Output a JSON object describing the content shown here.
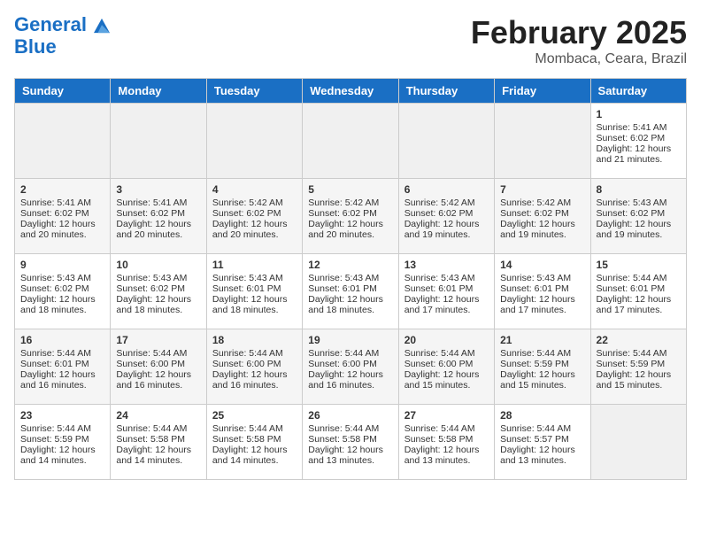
{
  "header": {
    "logo_line1": "General",
    "logo_line2": "Blue",
    "title": "February 2025",
    "subtitle": "Mombaca, Ceara, Brazil"
  },
  "days_of_week": [
    "Sunday",
    "Monday",
    "Tuesday",
    "Wednesday",
    "Thursday",
    "Friday",
    "Saturday"
  ],
  "weeks": [
    [
      {
        "num": "",
        "info": "",
        "empty": true
      },
      {
        "num": "",
        "info": "",
        "empty": true
      },
      {
        "num": "",
        "info": "",
        "empty": true
      },
      {
        "num": "",
        "info": "",
        "empty": true
      },
      {
        "num": "",
        "info": "",
        "empty": true
      },
      {
        "num": "",
        "info": "",
        "empty": true
      },
      {
        "num": "1",
        "info": "Sunrise: 5:41 AM\nSunset: 6:02 PM\nDaylight: 12 hours\nand 21 minutes.",
        "empty": false
      }
    ],
    [
      {
        "num": "2",
        "info": "Sunrise: 5:41 AM\nSunset: 6:02 PM\nDaylight: 12 hours\nand 20 minutes.",
        "empty": false
      },
      {
        "num": "3",
        "info": "Sunrise: 5:41 AM\nSunset: 6:02 PM\nDaylight: 12 hours\nand 20 minutes.",
        "empty": false
      },
      {
        "num": "4",
        "info": "Sunrise: 5:42 AM\nSunset: 6:02 PM\nDaylight: 12 hours\nand 20 minutes.",
        "empty": false
      },
      {
        "num": "5",
        "info": "Sunrise: 5:42 AM\nSunset: 6:02 PM\nDaylight: 12 hours\nand 20 minutes.",
        "empty": false
      },
      {
        "num": "6",
        "info": "Sunrise: 5:42 AM\nSunset: 6:02 PM\nDaylight: 12 hours\nand 19 minutes.",
        "empty": false
      },
      {
        "num": "7",
        "info": "Sunrise: 5:42 AM\nSunset: 6:02 PM\nDaylight: 12 hours\nand 19 minutes.",
        "empty": false
      },
      {
        "num": "8",
        "info": "Sunrise: 5:43 AM\nSunset: 6:02 PM\nDaylight: 12 hours\nand 19 minutes.",
        "empty": false
      }
    ],
    [
      {
        "num": "9",
        "info": "Sunrise: 5:43 AM\nSunset: 6:02 PM\nDaylight: 12 hours\nand 18 minutes.",
        "empty": false
      },
      {
        "num": "10",
        "info": "Sunrise: 5:43 AM\nSunset: 6:02 PM\nDaylight: 12 hours\nand 18 minutes.",
        "empty": false
      },
      {
        "num": "11",
        "info": "Sunrise: 5:43 AM\nSunset: 6:01 PM\nDaylight: 12 hours\nand 18 minutes.",
        "empty": false
      },
      {
        "num": "12",
        "info": "Sunrise: 5:43 AM\nSunset: 6:01 PM\nDaylight: 12 hours\nand 18 minutes.",
        "empty": false
      },
      {
        "num": "13",
        "info": "Sunrise: 5:43 AM\nSunset: 6:01 PM\nDaylight: 12 hours\nand 17 minutes.",
        "empty": false
      },
      {
        "num": "14",
        "info": "Sunrise: 5:43 AM\nSunset: 6:01 PM\nDaylight: 12 hours\nand 17 minutes.",
        "empty": false
      },
      {
        "num": "15",
        "info": "Sunrise: 5:44 AM\nSunset: 6:01 PM\nDaylight: 12 hours\nand 17 minutes.",
        "empty": false
      }
    ],
    [
      {
        "num": "16",
        "info": "Sunrise: 5:44 AM\nSunset: 6:01 PM\nDaylight: 12 hours\nand 16 minutes.",
        "empty": false
      },
      {
        "num": "17",
        "info": "Sunrise: 5:44 AM\nSunset: 6:00 PM\nDaylight: 12 hours\nand 16 minutes.",
        "empty": false
      },
      {
        "num": "18",
        "info": "Sunrise: 5:44 AM\nSunset: 6:00 PM\nDaylight: 12 hours\nand 16 minutes.",
        "empty": false
      },
      {
        "num": "19",
        "info": "Sunrise: 5:44 AM\nSunset: 6:00 PM\nDaylight: 12 hours\nand 16 minutes.",
        "empty": false
      },
      {
        "num": "20",
        "info": "Sunrise: 5:44 AM\nSunset: 6:00 PM\nDaylight: 12 hours\nand 15 minutes.",
        "empty": false
      },
      {
        "num": "21",
        "info": "Sunrise: 5:44 AM\nSunset: 5:59 PM\nDaylight: 12 hours\nand 15 minutes.",
        "empty": false
      },
      {
        "num": "22",
        "info": "Sunrise: 5:44 AM\nSunset: 5:59 PM\nDaylight: 12 hours\nand 15 minutes.",
        "empty": false
      }
    ],
    [
      {
        "num": "23",
        "info": "Sunrise: 5:44 AM\nSunset: 5:59 PM\nDaylight: 12 hours\nand 14 minutes.",
        "empty": false
      },
      {
        "num": "24",
        "info": "Sunrise: 5:44 AM\nSunset: 5:58 PM\nDaylight: 12 hours\nand 14 minutes.",
        "empty": false
      },
      {
        "num": "25",
        "info": "Sunrise: 5:44 AM\nSunset: 5:58 PM\nDaylight: 12 hours\nand 14 minutes.",
        "empty": false
      },
      {
        "num": "26",
        "info": "Sunrise: 5:44 AM\nSunset: 5:58 PM\nDaylight: 12 hours\nand 13 minutes.",
        "empty": false
      },
      {
        "num": "27",
        "info": "Sunrise: 5:44 AM\nSunset: 5:58 PM\nDaylight: 12 hours\nand 13 minutes.",
        "empty": false
      },
      {
        "num": "28",
        "info": "Sunrise: 5:44 AM\nSunset: 5:57 PM\nDaylight: 12 hours\nand 13 minutes.",
        "empty": false
      },
      {
        "num": "",
        "info": "",
        "empty": true
      }
    ]
  ]
}
